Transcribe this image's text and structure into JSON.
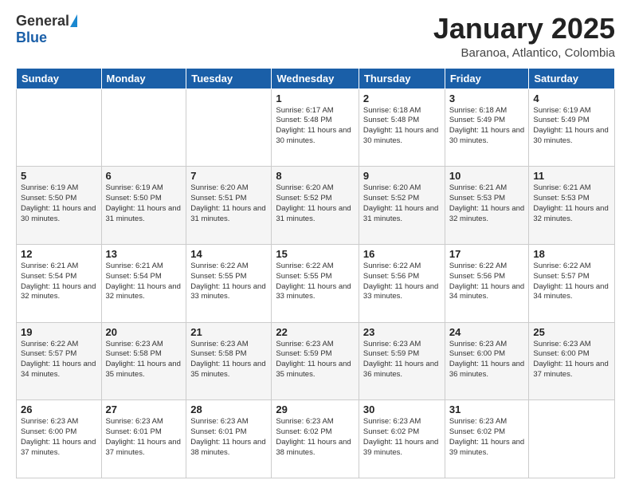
{
  "header": {
    "logo_general": "General",
    "logo_blue": "Blue",
    "title": "January 2025",
    "location": "Baranoa, Atlantico, Colombia"
  },
  "weekdays": [
    "Sunday",
    "Monday",
    "Tuesday",
    "Wednesday",
    "Thursday",
    "Friday",
    "Saturday"
  ],
  "weeks": [
    [
      {
        "day": "",
        "info": ""
      },
      {
        "day": "",
        "info": ""
      },
      {
        "day": "",
        "info": ""
      },
      {
        "day": "1",
        "info": "Sunrise: 6:17 AM\nSunset: 5:48 PM\nDaylight: 11 hours and 30 minutes."
      },
      {
        "day": "2",
        "info": "Sunrise: 6:18 AM\nSunset: 5:48 PM\nDaylight: 11 hours and 30 minutes."
      },
      {
        "day": "3",
        "info": "Sunrise: 6:18 AM\nSunset: 5:49 PM\nDaylight: 11 hours and 30 minutes."
      },
      {
        "day": "4",
        "info": "Sunrise: 6:19 AM\nSunset: 5:49 PM\nDaylight: 11 hours and 30 minutes."
      }
    ],
    [
      {
        "day": "5",
        "info": "Sunrise: 6:19 AM\nSunset: 5:50 PM\nDaylight: 11 hours and 30 minutes."
      },
      {
        "day": "6",
        "info": "Sunrise: 6:19 AM\nSunset: 5:50 PM\nDaylight: 11 hours and 31 minutes."
      },
      {
        "day": "7",
        "info": "Sunrise: 6:20 AM\nSunset: 5:51 PM\nDaylight: 11 hours and 31 minutes."
      },
      {
        "day": "8",
        "info": "Sunrise: 6:20 AM\nSunset: 5:52 PM\nDaylight: 11 hours and 31 minutes."
      },
      {
        "day": "9",
        "info": "Sunrise: 6:20 AM\nSunset: 5:52 PM\nDaylight: 11 hours and 31 minutes."
      },
      {
        "day": "10",
        "info": "Sunrise: 6:21 AM\nSunset: 5:53 PM\nDaylight: 11 hours and 32 minutes."
      },
      {
        "day": "11",
        "info": "Sunrise: 6:21 AM\nSunset: 5:53 PM\nDaylight: 11 hours and 32 minutes."
      }
    ],
    [
      {
        "day": "12",
        "info": "Sunrise: 6:21 AM\nSunset: 5:54 PM\nDaylight: 11 hours and 32 minutes."
      },
      {
        "day": "13",
        "info": "Sunrise: 6:21 AM\nSunset: 5:54 PM\nDaylight: 11 hours and 32 minutes."
      },
      {
        "day": "14",
        "info": "Sunrise: 6:22 AM\nSunset: 5:55 PM\nDaylight: 11 hours and 33 minutes."
      },
      {
        "day": "15",
        "info": "Sunrise: 6:22 AM\nSunset: 5:55 PM\nDaylight: 11 hours and 33 minutes."
      },
      {
        "day": "16",
        "info": "Sunrise: 6:22 AM\nSunset: 5:56 PM\nDaylight: 11 hours and 33 minutes."
      },
      {
        "day": "17",
        "info": "Sunrise: 6:22 AM\nSunset: 5:56 PM\nDaylight: 11 hours and 34 minutes."
      },
      {
        "day": "18",
        "info": "Sunrise: 6:22 AM\nSunset: 5:57 PM\nDaylight: 11 hours and 34 minutes."
      }
    ],
    [
      {
        "day": "19",
        "info": "Sunrise: 6:22 AM\nSunset: 5:57 PM\nDaylight: 11 hours and 34 minutes."
      },
      {
        "day": "20",
        "info": "Sunrise: 6:23 AM\nSunset: 5:58 PM\nDaylight: 11 hours and 35 minutes."
      },
      {
        "day": "21",
        "info": "Sunrise: 6:23 AM\nSunset: 5:58 PM\nDaylight: 11 hours and 35 minutes."
      },
      {
        "day": "22",
        "info": "Sunrise: 6:23 AM\nSunset: 5:59 PM\nDaylight: 11 hours and 35 minutes."
      },
      {
        "day": "23",
        "info": "Sunrise: 6:23 AM\nSunset: 5:59 PM\nDaylight: 11 hours and 36 minutes."
      },
      {
        "day": "24",
        "info": "Sunrise: 6:23 AM\nSunset: 6:00 PM\nDaylight: 11 hours and 36 minutes."
      },
      {
        "day": "25",
        "info": "Sunrise: 6:23 AM\nSunset: 6:00 PM\nDaylight: 11 hours and 37 minutes."
      }
    ],
    [
      {
        "day": "26",
        "info": "Sunrise: 6:23 AM\nSunset: 6:00 PM\nDaylight: 11 hours and 37 minutes."
      },
      {
        "day": "27",
        "info": "Sunrise: 6:23 AM\nSunset: 6:01 PM\nDaylight: 11 hours and 37 minutes."
      },
      {
        "day": "28",
        "info": "Sunrise: 6:23 AM\nSunset: 6:01 PM\nDaylight: 11 hours and 38 minutes."
      },
      {
        "day": "29",
        "info": "Sunrise: 6:23 AM\nSunset: 6:02 PM\nDaylight: 11 hours and 38 minutes."
      },
      {
        "day": "30",
        "info": "Sunrise: 6:23 AM\nSunset: 6:02 PM\nDaylight: 11 hours and 39 minutes."
      },
      {
        "day": "31",
        "info": "Sunrise: 6:23 AM\nSunset: 6:02 PM\nDaylight: 11 hours and 39 minutes."
      },
      {
        "day": "",
        "info": ""
      }
    ]
  ]
}
